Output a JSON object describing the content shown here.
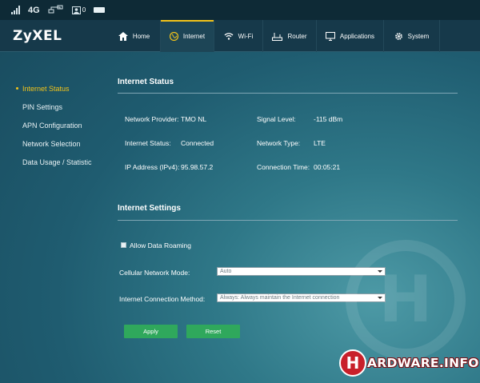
{
  "status_bar": {
    "network_type": "4G",
    "message_count": "0"
  },
  "header": {
    "logo": "ZyXEL",
    "nav": [
      {
        "label": "Home",
        "icon": "home-icon"
      },
      {
        "label": "Internet",
        "icon": "globe-icon"
      },
      {
        "label": "Wi-Fi",
        "icon": "wifi-icon"
      },
      {
        "label": "Router",
        "icon": "router-icon"
      },
      {
        "label": "Applications",
        "icon": "monitor-icon"
      },
      {
        "label": "System",
        "icon": "gear-icon"
      }
    ],
    "active_nav": "Internet"
  },
  "sidebar": {
    "items": [
      {
        "label": "Internet Status"
      },
      {
        "label": "PIN Settings"
      },
      {
        "label": "APN Configuration"
      },
      {
        "label": "Network Selection"
      },
      {
        "label": "Data Usage / Statistic"
      }
    ],
    "active_item": "Internet Status"
  },
  "internet_status": {
    "title": "Internet Status",
    "network_provider_label": "Network Provider:",
    "network_provider_value": "TMO NL",
    "signal_level_label": "Signal Level:",
    "signal_level_value": "-115 dBm",
    "internet_status_label": "Internet Status:",
    "internet_status_value": "Connected",
    "network_type_label": "Network Type:",
    "network_type_value": "LTE",
    "ip_address_label": "IP Address (IPv4):",
    "ip_address_value": "95.98.57.2",
    "connection_time_label": "Connection Time:",
    "connection_time_value": "00:05:21"
  },
  "internet_settings": {
    "title": "Internet Settings",
    "allow_roaming_label": "Allow Data Roaming",
    "cellular_mode_label": "Cellular Network Mode:",
    "cellular_mode_value": "Auto",
    "connection_method_label": "Internet Connection Method:",
    "connection_method_value": "Always: Always maintain the Internet connection",
    "apply_label": "Apply",
    "reset_label": "Reset"
  },
  "watermark": {
    "badge": "H",
    "text": "ARDWARE.INFO"
  },
  "colors": {
    "accent": "#f2c31a",
    "button": "#2fa85c",
    "header": "#16394a"
  }
}
